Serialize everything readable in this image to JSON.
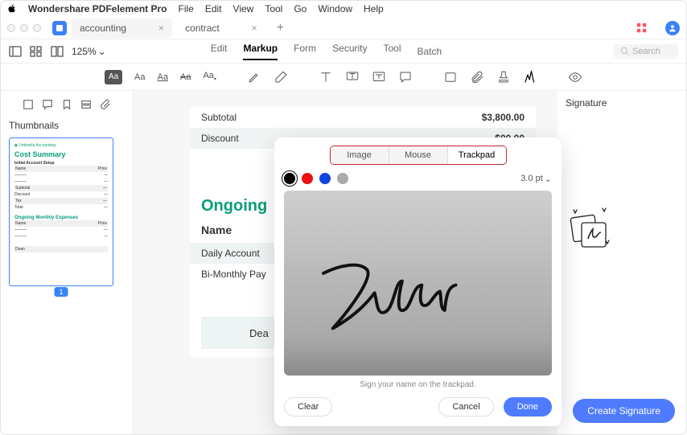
{
  "menubar": {
    "app": "Wondershare PDFelement Pro",
    "items": [
      "File",
      "Edit",
      "View",
      "Tool",
      "Go",
      "Window",
      "Help"
    ]
  },
  "tabs": [
    {
      "label": "accounting"
    },
    {
      "label": "contract"
    }
  ],
  "zoom": "125%",
  "topmenu": {
    "items": [
      "Edit",
      "Markup",
      "Form",
      "Security",
      "Tool",
      "Batch"
    ],
    "active": "Markup"
  },
  "search": {
    "placeholder": "Search"
  },
  "sidebar": {
    "title": "Thumbnails",
    "page_badge": "1",
    "thumb": {
      "brand": "Umbrella Accounting",
      "title": "Cost Summary",
      "s1": "Initial Account Setup",
      "s2": "Ongoing Monthly Expenses"
    }
  },
  "doc": {
    "subtotal": {
      "label": "Subtotal",
      "value": "$3,800.00"
    },
    "discount": {
      "label": "Discount",
      "value": "$00.00"
    },
    "ongoing": "Ongoing",
    "name_label": "Name",
    "rows": [
      "Daily Account",
      "Bi-Monthly Pay"
    ],
    "sig_name": "Dea"
  },
  "right": {
    "label": "Signature",
    "create": "Create Signature"
  },
  "modal": {
    "tabs": [
      "Image",
      "Mouse",
      "Trackpad"
    ],
    "active": "Trackpad",
    "stroke": "3.0 pt",
    "hint": "Sign your name on the trackpad.",
    "clear": "Clear",
    "cancel": "Cancel",
    "done": "Done"
  }
}
